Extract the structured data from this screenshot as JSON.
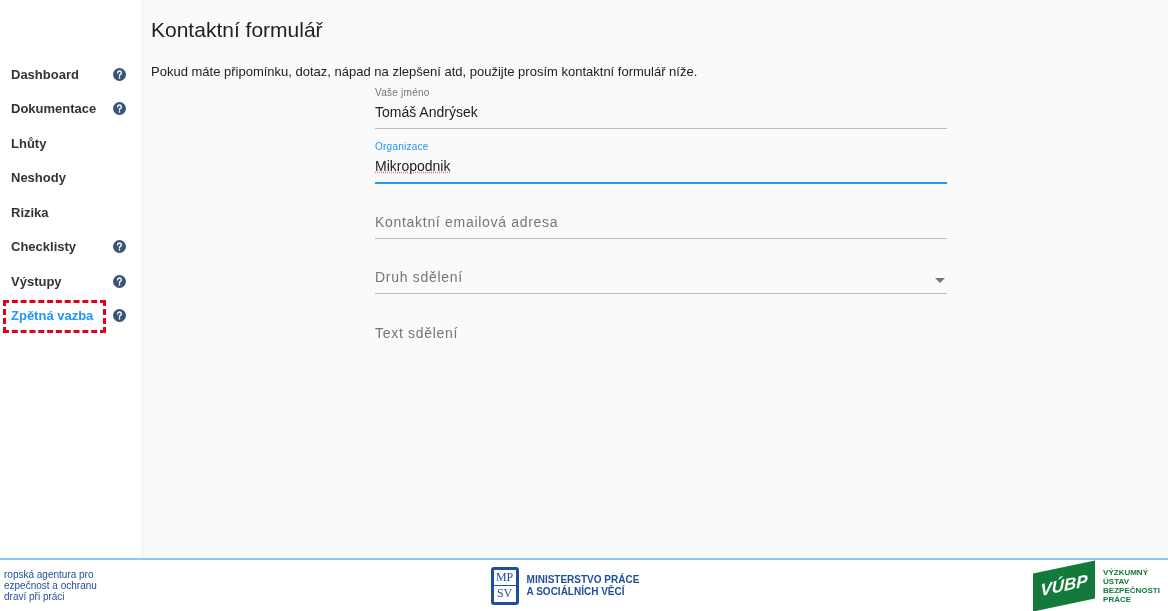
{
  "sidebar": {
    "items": [
      {
        "label": "Dashboard",
        "help": true,
        "selected": false,
        "highlighted": false
      },
      {
        "label": "Dokumentace",
        "help": true,
        "selected": false,
        "highlighted": false
      },
      {
        "label": "Lhůty",
        "help": false,
        "selected": false,
        "highlighted": false
      },
      {
        "label": "Neshody",
        "help": false,
        "selected": false,
        "highlighted": false
      },
      {
        "label": "Rizika",
        "help": false,
        "selected": false,
        "highlighted": false
      },
      {
        "label": "Checklisty",
        "help": true,
        "selected": false,
        "highlighted": false
      },
      {
        "label": "Výstupy",
        "help": true,
        "selected": false,
        "highlighted": false
      },
      {
        "label": "Zpětná vazba",
        "help": true,
        "selected": true,
        "highlighted": true
      }
    ]
  },
  "page": {
    "title": "Kontaktní formulář",
    "intro": "Pokud máte připomínku, dotaz, nápad na zlepšení atd, použijte prosím kontaktní formulář níže."
  },
  "form": {
    "fields": [
      {
        "kind": "text",
        "label": "Vaše jméno",
        "value": "Tomáš Andrýsek",
        "focused": false
      },
      {
        "kind": "text",
        "label": "Organizace",
        "value": "Mikropodnik",
        "focused": true
      },
      {
        "kind": "text",
        "label": "Kontaktní emailová adresa",
        "focused": false
      },
      {
        "kind": "select",
        "label": "Druh sdělení",
        "focused": false
      },
      {
        "kind": "textarea",
        "label": "Text sdělení",
        "focused": false
      }
    ]
  },
  "footer": {
    "logos": [
      {
        "kind": "text",
        "lines": [
          "ropská agentura pro",
          "ezpečnost a ochranu",
          "draví při práci"
        ]
      },
      {
        "kind": "mpsv",
        "mark": [
          "MP",
          "SV"
        ],
        "lines": [
          "MINISTERSTVO PRÁCE",
          "A SOCIÁLNÍCH VĚCÍ"
        ]
      },
      {
        "kind": "vubp",
        "mark": [
          "VÚBP"
        ],
        "lines": [
          "VÝZKUMNÝ",
          "ÚSTAV",
          "BEZPEČNOSTI",
          "PRÁCE"
        ]
      }
    ]
  }
}
